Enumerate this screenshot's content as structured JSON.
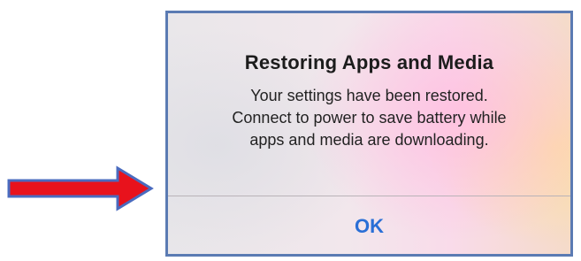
{
  "alert": {
    "title": "Restoring Apps and Media",
    "message_lines": [
      "Your settings have been restored.",
      "Connect to power to save battery while",
      "apps and media are downloading."
    ],
    "button_label": "OK"
  },
  "annotation": {
    "arrow_fill": "#e8121c",
    "arrow_outline": "#4a6bbf"
  },
  "colors": {
    "frame_border": "#5b7bb3",
    "button_text": "#2a6fd6"
  }
}
